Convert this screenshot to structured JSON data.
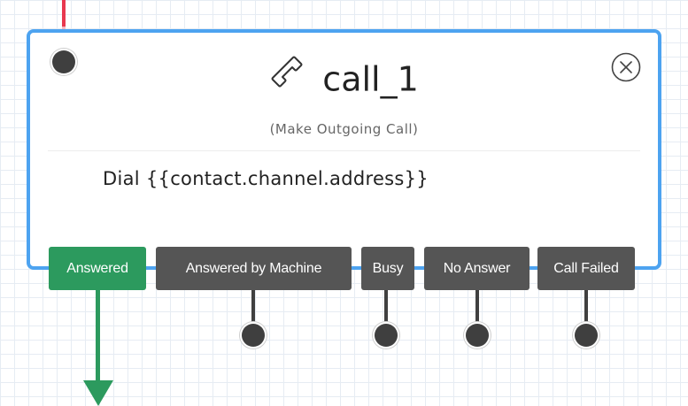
{
  "node": {
    "title": "call_1",
    "subtitle": "(Make Outgoing Call)",
    "description": "Dial {{contact.channel.address}}",
    "icon": "phone-icon",
    "close_icon": "close-circle-icon"
  },
  "outcomes": [
    {
      "label": "Answered",
      "color": "#2c9a5e"
    },
    {
      "label": "Answered by Machine",
      "color": "#555555"
    },
    {
      "label": "Busy",
      "color": "#555555"
    },
    {
      "label": "No Answer",
      "color": "#555555"
    },
    {
      "label": "Call Failed",
      "color": "#555555"
    }
  ],
  "colors": {
    "node_border": "#4da3f0",
    "incoming_connection": "#e8384f",
    "answered_connection": "#2c9a5e",
    "port": "#3f3f3f",
    "grid": "#e6ecf3"
  }
}
